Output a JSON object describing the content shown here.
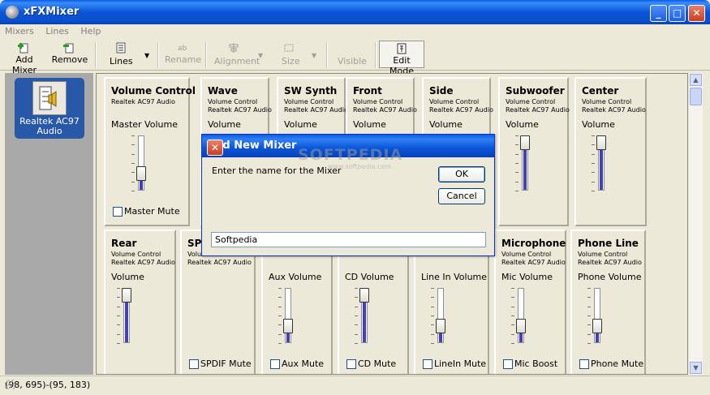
{
  "window": {
    "title": "xFXMixer",
    "controls": {
      "minimize": "_",
      "maximize": "□",
      "close": "✕"
    }
  },
  "menu": [
    "Mixers",
    "Lines",
    "Help"
  ],
  "toolbar": {
    "add_mixer": "Add Mixer",
    "remove": "Remove",
    "lines": "Lines",
    "rename": "Rename",
    "alignment": "Alignment",
    "size": "Size",
    "visible": "Visible",
    "edit_mode": "Edit Mode"
  },
  "devices": [
    {
      "label": "Realtek AC97 Audio"
    }
  ],
  "strips_top": [
    {
      "name": "Volume Control",
      "device": "Realtek AC97 Audio",
      "control": "Master Volume",
      "level": 0.25,
      "checkbox": "Master Mute"
    },
    {
      "name": "Wave",
      "sub": "Volume Control",
      "device": "Realtek AC97 Audio",
      "control": "Volume"
    },
    {
      "name": "SW Synth",
      "sub": "Volume Control",
      "device": "Realtek AC97 Audio",
      "control": "Volume"
    },
    {
      "name": "Front",
      "sub": "Volume Control",
      "device": "Realtek AC97 Audio",
      "control": "Volume"
    },
    {
      "name": "Side",
      "sub": "Volume Control",
      "device": "Realtek AC97 Audio",
      "control": "Volume"
    },
    {
      "name": "Subwoofer",
      "sub": "Volume Control",
      "device": "Realtek AC97 Audio",
      "control": "Volume",
      "level": 1.0
    },
    {
      "name": "Center",
      "sub": "Volume Control",
      "device": "Realtek AC97 Audio",
      "control": "Volume",
      "level": 1.0
    }
  ],
  "strips_bottom": [
    {
      "name": "Rear",
      "sub": "Volume Control",
      "device": "Realtek AC97 Audio",
      "control": "Volume",
      "level": 1.0
    },
    {
      "name": "SPDI",
      "sub": "Volume Control",
      "device": "Realtek AC97 Audio",
      "control": "",
      "checkbox": "SPDIF Mute"
    },
    {
      "name": "",
      "sub": "",
      "device": "",
      "control": "Aux Volume",
      "level": 0.25,
      "checkbox": "Aux Mute"
    },
    {
      "name": "",
      "sub": "",
      "device": "",
      "control": "CD Volume",
      "level": 1.0,
      "checkbox": "CD Mute"
    },
    {
      "name": "",
      "sub": "",
      "device": "",
      "control": "Line In Volume",
      "level": 0.25,
      "checkbox": "LineIn Mute"
    },
    {
      "name": "Microphone",
      "sub": "Volume Control",
      "device": "Realtek AC97 Audio",
      "control": "Mic Volume",
      "level": 0.25,
      "checkbox": "Mic Boost"
    },
    {
      "name": "Phone Line",
      "sub": "Volume Control",
      "device": "Realtek AC97 Audio",
      "control": "Phone Volume",
      "level": 0.25,
      "checkbox": "Phone Mute"
    }
  ],
  "dialog": {
    "title": "Add New Mixer",
    "prompt": "Enter the name for the Mixer",
    "ok": "OK",
    "cancel": "Cancel",
    "value": "Softpedia",
    "close": "✕"
  },
  "watermark": {
    "text": "SOFTPEDIA",
    "sub": "www.softpedia.com"
  },
  "statusbar": {
    "text": "(98, 695)-(95, 183)"
  },
  "scroll": {
    "up": "▲",
    "down": "▼"
  }
}
